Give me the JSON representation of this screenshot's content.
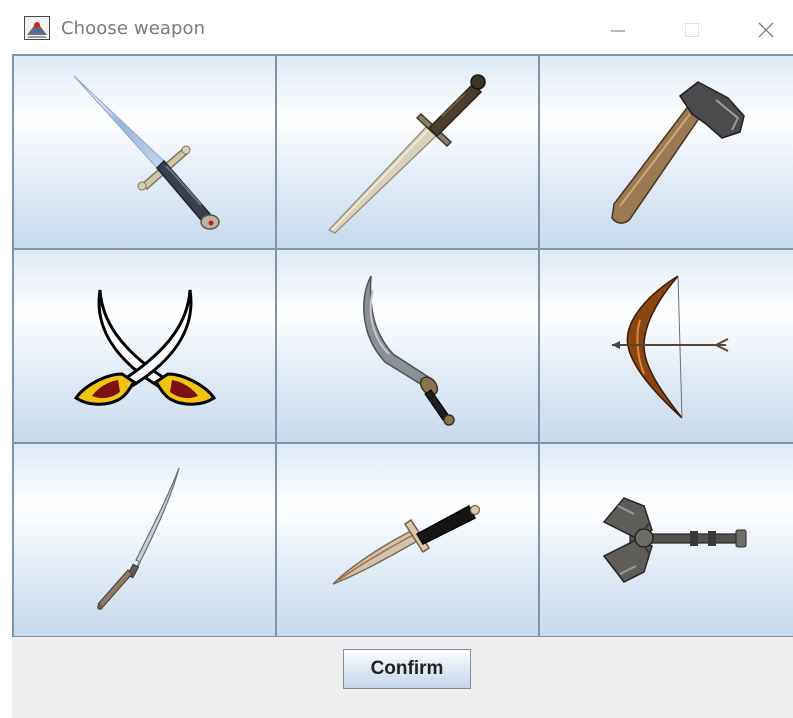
{
  "window": {
    "title": "Choose weapon",
    "icon": "java-app-icon",
    "controls": [
      "minimize-icon",
      "maximize-icon",
      "close-icon"
    ]
  },
  "weapons": [
    {
      "name": "longsword",
      "icon": "longsword-icon"
    },
    {
      "name": "gladius",
      "icon": "gladius-icon"
    },
    {
      "name": "axe",
      "icon": "axe-icon"
    },
    {
      "name": "crossed-sabres",
      "icon": "crossed-sabres-icon"
    },
    {
      "name": "scimitar",
      "icon": "scimitar-icon"
    },
    {
      "name": "bow",
      "icon": "bow-and-arrow-icon"
    },
    {
      "name": "katana",
      "icon": "katana-icon"
    },
    {
      "name": "dagger",
      "icon": "dagger-icon"
    },
    {
      "name": "battle-axe",
      "icon": "battle-axe-icon"
    }
  ],
  "footer": {
    "confirm_label": "Confirm"
  },
  "colors": {
    "grid_border": "#8193a6",
    "cell_top": "#dde9f5",
    "cell_mid": "#ffffff",
    "cell_bottom": "#c8d9ec",
    "footer_bg": "#eeeeee"
  }
}
